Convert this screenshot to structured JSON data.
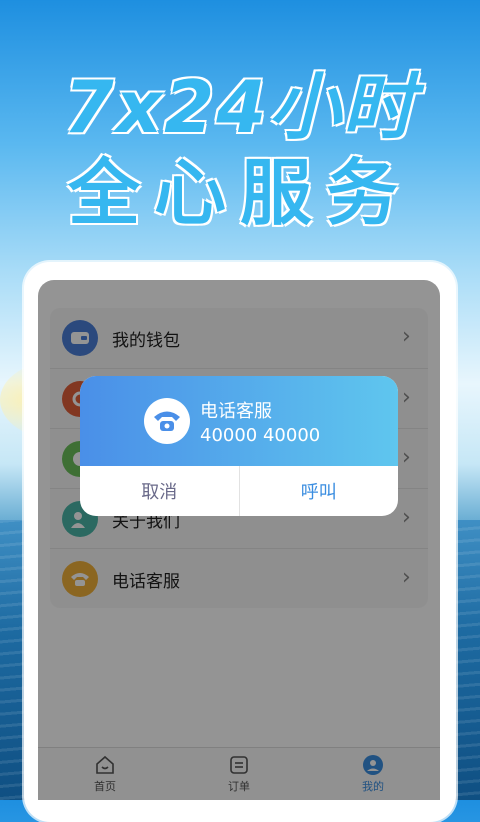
{
  "banner": {
    "line1": "7x24小时",
    "line2": "全心服务"
  },
  "menu": {
    "items": [
      {
        "label": "我的钱包",
        "icon": "wallet-icon",
        "color": "#4a7fd8"
      },
      {
        "label": "",
        "icon": "settings-icon",
        "color": "#e0603a"
      },
      {
        "label": "",
        "icon": "message-icon",
        "color": "#6bbf5a"
      },
      {
        "label": "关于我们",
        "icon": "about-icon",
        "color": "#4ab6a8"
      },
      {
        "label": "电话客服",
        "icon": "phone-icon",
        "color": "#f0b03a"
      }
    ]
  },
  "dialog": {
    "title": "电话客服",
    "number": "40000 40000",
    "cancel_label": "取消",
    "call_label": "呼叫"
  },
  "tabs": [
    {
      "label": "首页",
      "icon": "home-icon"
    },
    {
      "label": "订单",
      "icon": "order-icon"
    },
    {
      "label": "我的",
      "icon": "profile-icon",
      "active_color": "#3a8de0"
    }
  ]
}
